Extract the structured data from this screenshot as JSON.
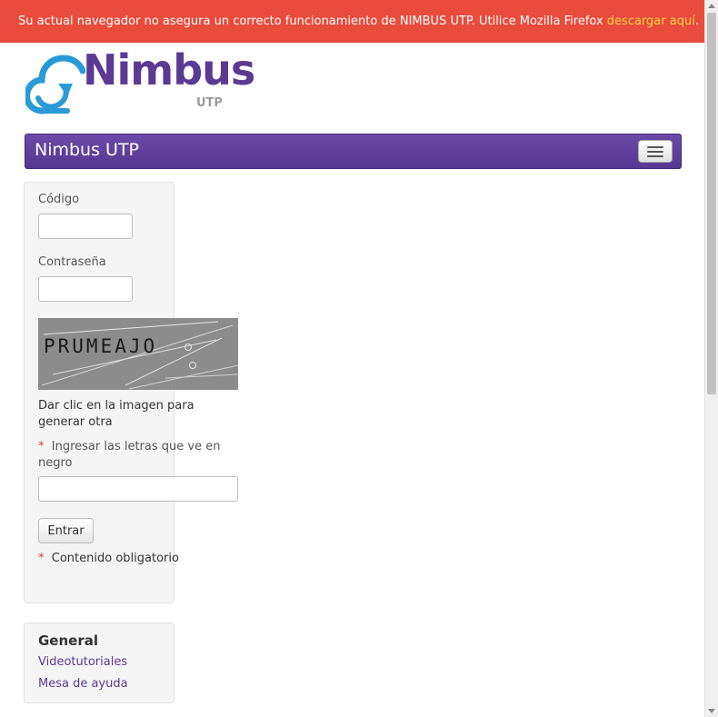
{
  "alert": {
    "message": "Su actual navegador no asegura un correcto funcionamiento de NIMBUS UTP. Utilice Mozilla Firefox ",
    "link_text": "descargar aquí",
    "suffix": "."
  },
  "logo": {
    "word": "Nimbus",
    "sub": "UTP",
    "icon": "cloud-arrow-icon"
  },
  "navbar": {
    "brand": "Nimbus UTP",
    "toggle_icon": "hamburger-menu-icon"
  },
  "login": {
    "code_label": "Código",
    "code_value": "",
    "password_label": "Contraseña",
    "password_value": "",
    "captcha_text": "PRUMEAJO",
    "captcha_help": "Dar clic en la imagen para generar otra",
    "required_mark": "*",
    "captcha_field_label": "Ingresar las letras que ve en negro",
    "captcha_field_value": "",
    "submit_label": "Entrar",
    "required_note": "Contenido obligatorio"
  },
  "general": {
    "title": "General",
    "links": [
      "Videotutoriales",
      "Mesa de ayuda"
    ]
  },
  "colors": {
    "alert_bg": "#e94b3c",
    "alert_link": "#f9d648",
    "brand_purple": "#5a3a92",
    "logo_blue": "#2a9ad6"
  }
}
